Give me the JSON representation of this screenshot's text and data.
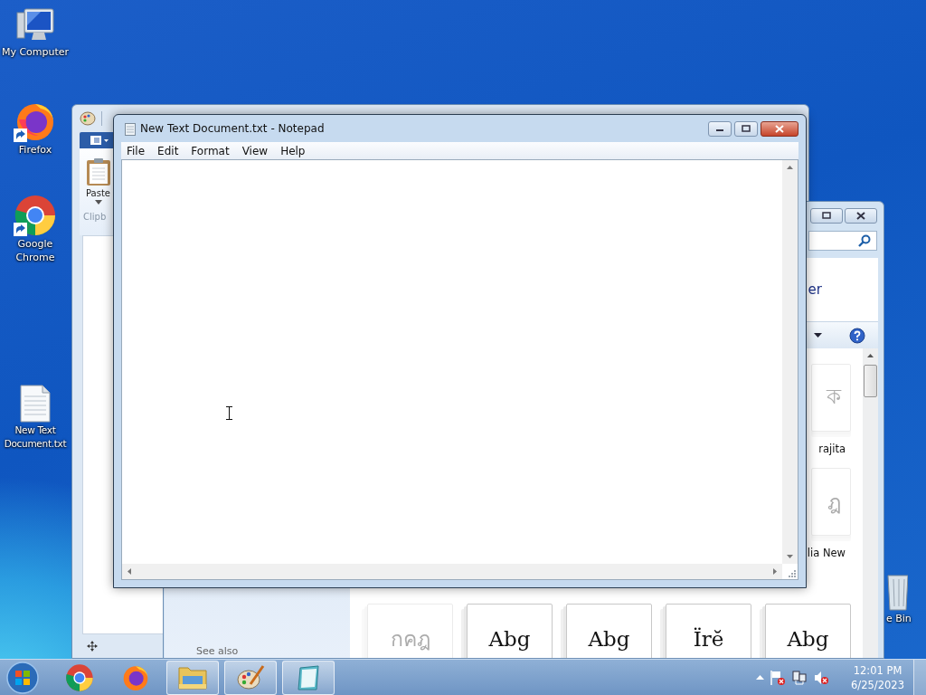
{
  "desktop_icons": [
    {
      "kind": "computer",
      "label": "My Computer",
      "shortcut": false
    },
    {
      "kind": "firefox",
      "label": "Firefox",
      "shortcut": true
    },
    {
      "kind": "chrome",
      "label": "Google Chrome",
      "shortcut": true
    },
    {
      "kind": "textfile",
      "label": "New Text Document.txt",
      "shortcut": false
    }
  ],
  "recycle_bin": {
    "label": "e Bin"
  },
  "paint_window": {
    "paste_label": "Paste",
    "group_label": "Clipb"
  },
  "fonts_window": {
    "heading": "er",
    "see_also": "See also",
    "fonts": [
      {
        "sample": "ক",
        "label": "rajita",
        "hidden": true
      },
      {
        "sample": "ฎ",
        "label": "lia New",
        "hidden": true
      },
      {
        "sample": "กคฎ",
        "hidden": true
      },
      {
        "sample": "Abg",
        "hidden": false
      },
      {
        "sample": "Abg",
        "hidden": false
      },
      {
        "sample": "Ïrĕ",
        "hidden": false
      },
      {
        "sample": "Abg",
        "hidden": false
      }
    ]
  },
  "notepad": {
    "title": "New Text Document.txt - Notepad",
    "menu": [
      "File",
      "Edit",
      "Format",
      "View",
      "Help"
    ]
  },
  "taskbar": {
    "items": [
      {
        "kind": "chrome",
        "running": false
      },
      {
        "kind": "firefox",
        "running": false
      },
      {
        "kind": "explorer",
        "running": true
      },
      {
        "kind": "paint",
        "running": true
      },
      {
        "kind": "notepad",
        "running": true
      }
    ],
    "clock": {
      "time": "12:01 PM",
      "date": "6/25/2023"
    }
  }
}
